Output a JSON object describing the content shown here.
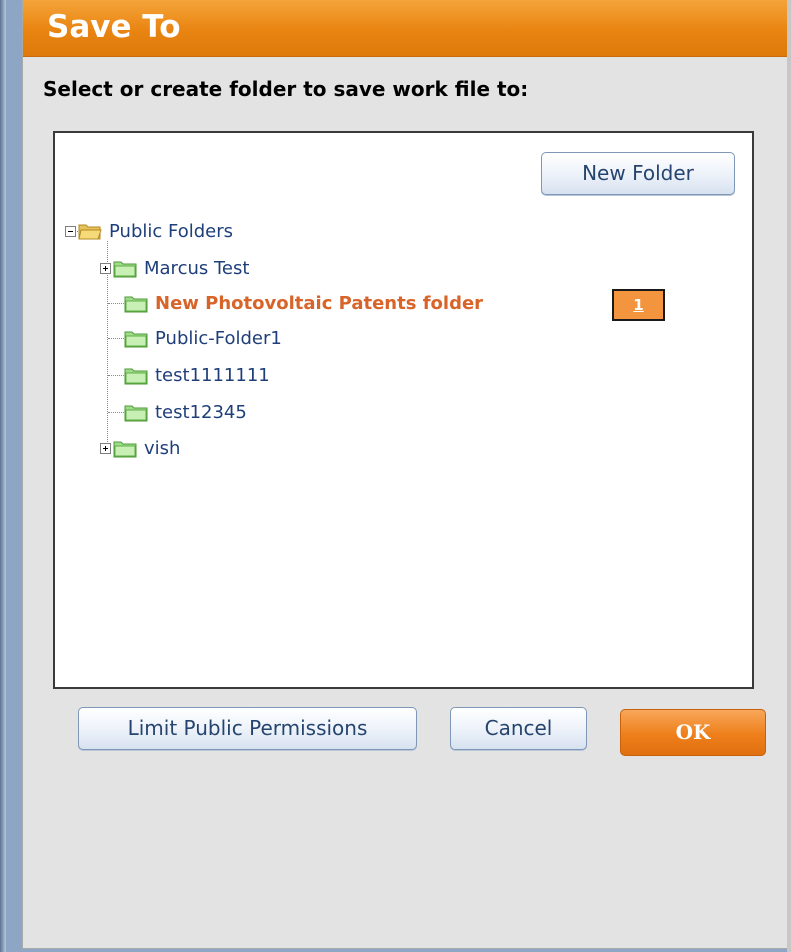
{
  "dialog": {
    "title": "Save To",
    "instructions": "Select or create folder to save work file to:",
    "new_folder_label": "New Folder",
    "buttons": {
      "limit_permissions": "Limit Public Permissions",
      "cancel": "Cancel",
      "ok": "OK"
    }
  },
  "tree": {
    "root": {
      "label": "Public Folders",
      "expanded": true,
      "icon": "folder-open-icon"
    },
    "items": [
      {
        "label": "Marcus Test",
        "has_children": true,
        "selected": false,
        "icon": "folder-icon"
      },
      {
        "label": "New Photovoltaic Patents folder",
        "has_children": false,
        "selected": true,
        "icon": "folder-icon"
      },
      {
        "label": "Public-Folder1",
        "has_children": false,
        "selected": false,
        "icon": "folder-icon"
      },
      {
        "label": "test1111111",
        "has_children": false,
        "selected": false,
        "icon": "folder-icon"
      },
      {
        "label": "test12345",
        "has_children": false,
        "selected": false,
        "icon": "folder-icon"
      },
      {
        "label": "vish",
        "has_children": true,
        "selected": false,
        "icon": "folder-icon"
      }
    ]
  },
  "annotation_badge": "1",
  "colors": {
    "title_bar": "#e98411",
    "selected_text": "#d8642a",
    "link_text": "#1f3f7a",
    "ok_button": "#ee7f1a"
  }
}
